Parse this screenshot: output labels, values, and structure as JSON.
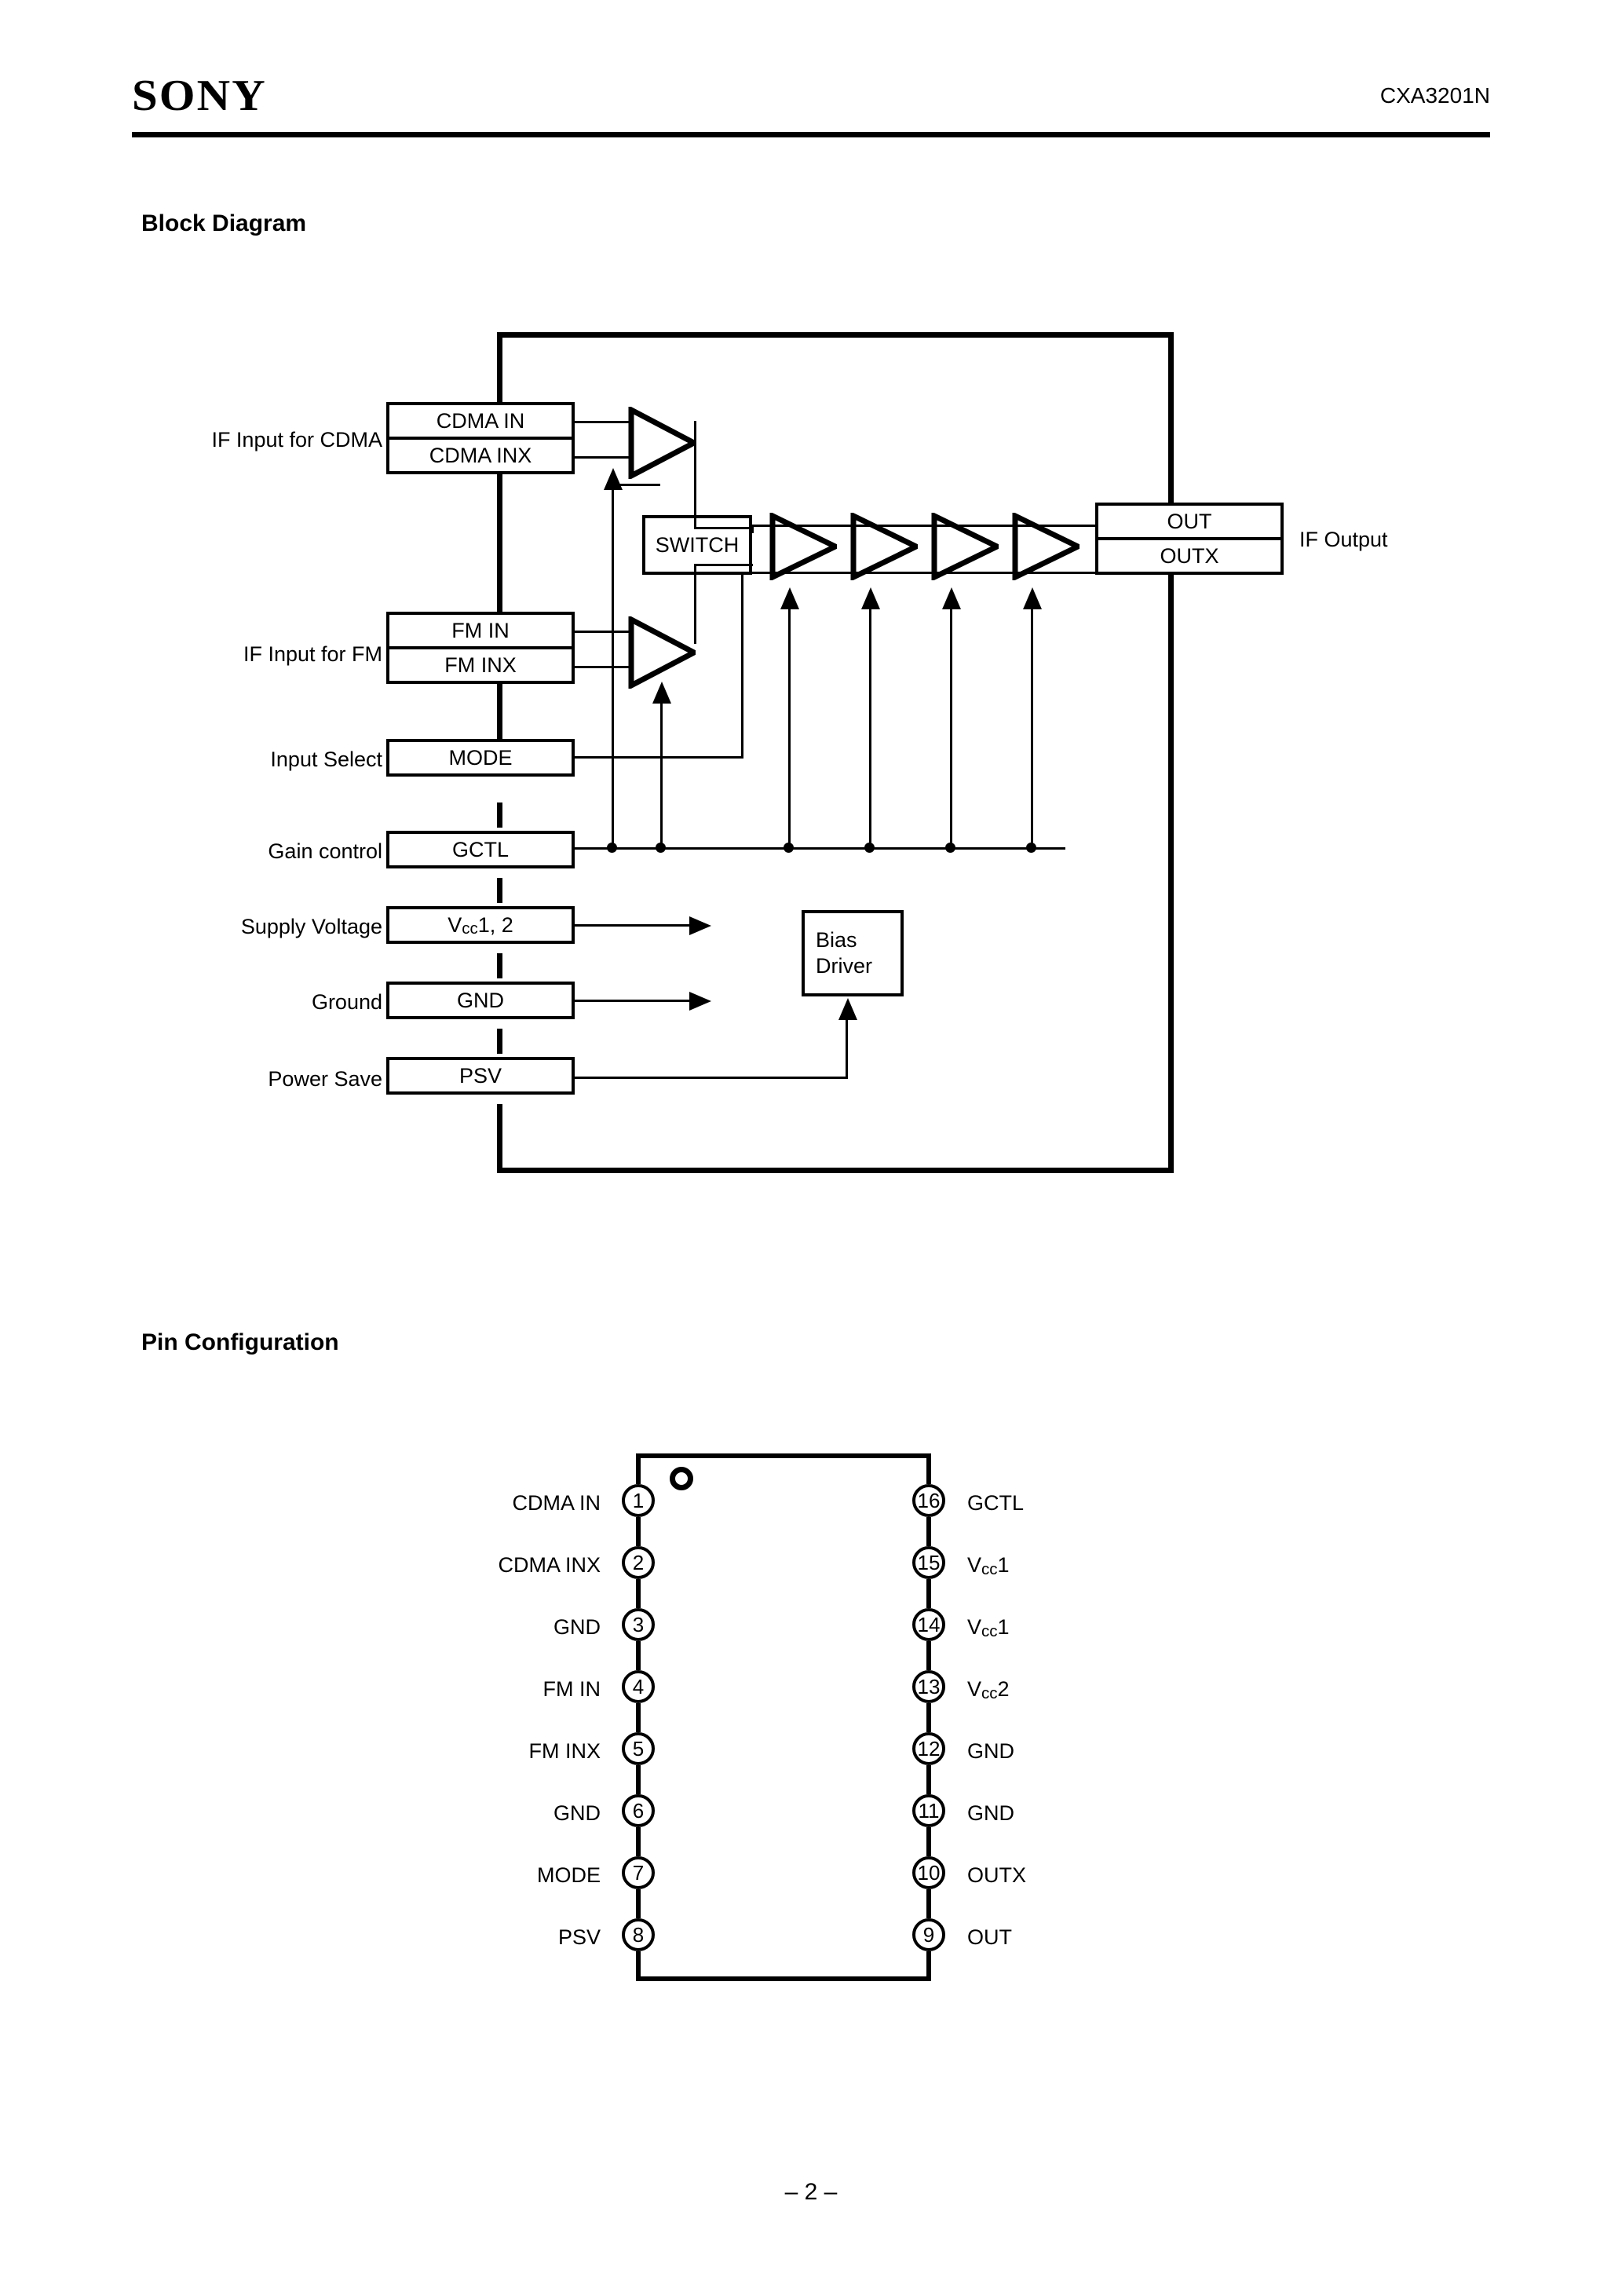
{
  "header": {
    "logo": "SONY",
    "part_number": "CXA3201N"
  },
  "footer": {
    "page_marker": "– 2 –"
  },
  "sections": {
    "block_diagram_heading": "Block Diagram",
    "pin_configuration_heading": "Pin Configuration"
  },
  "block_diagram": {
    "left_labels": [
      "IF Input for CDMA",
      "IF Input for FM",
      "Input Select",
      "Gain control",
      "Supply Voltage",
      "Ground",
      "Power Save"
    ],
    "pin_boxes": [
      {
        "name": "cdma-in",
        "label": "CDMA IN"
      },
      {
        "name": "cdma-inx",
        "label": "CDMA INX"
      },
      {
        "name": "fm-in",
        "label": "FM IN"
      },
      {
        "name": "fm-inx",
        "label": "FM INX"
      },
      {
        "name": "mode",
        "label": "MODE"
      },
      {
        "name": "gctl",
        "label": "GCTL"
      },
      {
        "name": "vcc",
        "label": "Vcc1, 2"
      },
      {
        "name": "gnd",
        "label": "GND"
      },
      {
        "name": "psv",
        "label": "PSV"
      },
      {
        "name": "out",
        "label": "OUT"
      },
      {
        "name": "outx",
        "label": "OUTX"
      }
    ],
    "internal_blocks": [
      {
        "name": "switch",
        "label": "SWITCH"
      },
      {
        "name": "bias-driver",
        "label_line1": "Bias",
        "label_line2": "Driver"
      }
    ],
    "right_labels": [
      "IF Output"
    ],
    "amplifier_count": 6
  },
  "pin_configuration": {
    "left_pins": [
      {
        "number": "1",
        "label": "CDMA IN"
      },
      {
        "number": "2",
        "label": "CDMA INX"
      },
      {
        "number": "3",
        "label": "GND"
      },
      {
        "number": "4",
        "label": "FM IN"
      },
      {
        "number": "5",
        "label": "FM INX"
      },
      {
        "number": "6",
        "label": "GND"
      },
      {
        "number": "7",
        "label": "MODE"
      },
      {
        "number": "8",
        "label": "PSV"
      }
    ],
    "right_pins": [
      {
        "number": "16",
        "label": "GCTL"
      },
      {
        "number": "15",
        "label": "Vcc1"
      },
      {
        "number": "14",
        "label": "Vcc1"
      },
      {
        "number": "13",
        "label": "Vcc2"
      },
      {
        "number": "12",
        "label": "GND"
      },
      {
        "number": "11",
        "label": "GND"
      },
      {
        "number": "10",
        "label": "OUTX"
      },
      {
        "number": "9",
        "label": "OUT"
      }
    ]
  },
  "colors": {
    "ink": "#000000",
    "paper": "#ffffff"
  }
}
